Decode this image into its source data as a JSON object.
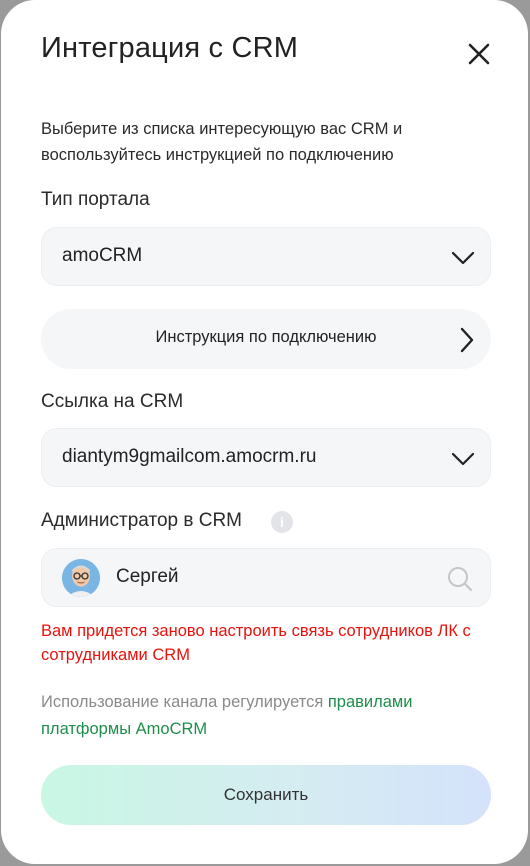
{
  "modal": {
    "title": "Интеграция с CRM",
    "description": "Выберите из списка интересующую вас CRM и воспользуйтесь инструкцией по подключению"
  },
  "portal": {
    "label": "Тип портала",
    "value": "amoCRM"
  },
  "instruction": {
    "label": "Инструкция по подключению"
  },
  "crm_link": {
    "label": "Ссылка на CRM",
    "value": "diantym9gmailcom.amocrm.ru"
  },
  "admin": {
    "label": "Администратор в CRM",
    "info_icon_text": "i",
    "value": "Сергей"
  },
  "warning": {
    "text": "Вам придется заново настроить связь сотрудников ЛК с сотрудниками CRM",
    "color": "#e8120c"
  },
  "policy": {
    "text": "Использование канала регулируется ",
    "link_text": "правилами платформы AmoCRM",
    "link_color": "#1e8e4a"
  },
  "save_button": {
    "label": "Сохранить"
  },
  "icons": {
    "close": "close-icon",
    "dropdown": "chevron-down-icon",
    "arrow": "chevron-right-icon",
    "search": "search-icon",
    "info": "info-icon",
    "avatar": "user-avatar"
  }
}
